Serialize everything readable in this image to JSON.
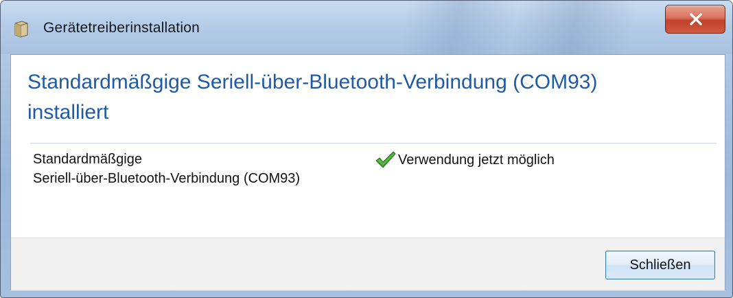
{
  "window": {
    "title": "Gerätetreiberinstallation",
    "title_icon": "driver-box-icon",
    "close_icon": "close-x-icon"
  },
  "content": {
    "heading_line1": "Standardmäßgige Seriell-über-Bluetooth-Verbindung (COM93)",
    "heading_line2": "installiert",
    "device_name_line1": "Standardmäßgige",
    "device_name_line2": "Seriell-über-Bluetooth-Verbindung (COM93)",
    "status_icon": "green-checkmark-icon",
    "status_text": "Verwendung jetzt möglich"
  },
  "footer": {
    "close_button_label": "Schließen"
  },
  "colors": {
    "heading": "#1f5aa7",
    "check": "#3a9a2a",
    "close_button_bg": "#c2402a",
    "footer_bg": "#f0f0f0"
  }
}
